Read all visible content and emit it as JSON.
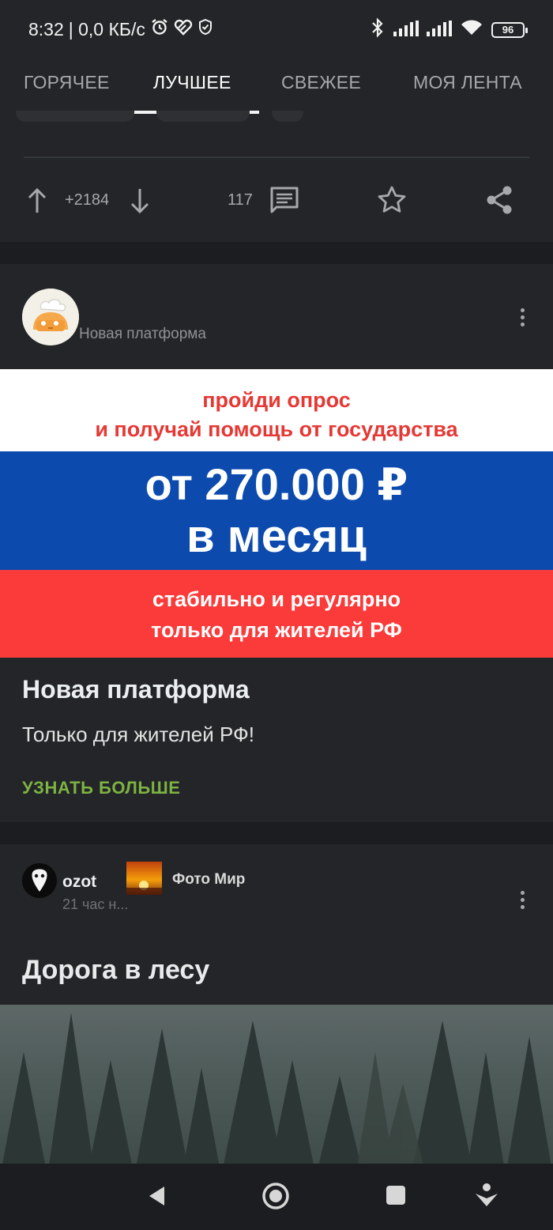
{
  "status_bar": {
    "time": "8:32",
    "net_speed": "| 0,0 КБ/с",
    "battery": "96"
  },
  "tabs": [
    {
      "label": "ГОРЯЧЕЕ",
      "active": false
    },
    {
      "label": "ЛУЧШЕЕ",
      "active": true
    },
    {
      "label": "СВЕЖЕЕ",
      "active": false
    },
    {
      "label": "МОЯ ЛЕНТА",
      "active": false
    }
  ],
  "post_actions": {
    "rating": "+2184",
    "comments": "117"
  },
  "ad_card": {
    "source": "Новая платформа",
    "banner": {
      "line1": "пройди опрос",
      "line2": "и получай помощь от государства",
      "amount": "от 270.000 ₽",
      "period": "в месяц",
      "line5": "стабильно и регулярно",
      "line6": "только для жителей РФ"
    },
    "title": "Новая платформа",
    "description": "Только для жителей РФ!",
    "cta": "УЗНАТЬ БОЛЬШЕ"
  },
  "post": {
    "author": "ozot",
    "time": "21 час н...",
    "community": "Фото Мир",
    "title": "Дорога в лесу"
  },
  "colors": {
    "background": "#1c1d20",
    "card": "#232528",
    "accent_green": "#7cb342",
    "flag_blue": "#0c4aad",
    "flag_red": "#fb3a3a"
  }
}
